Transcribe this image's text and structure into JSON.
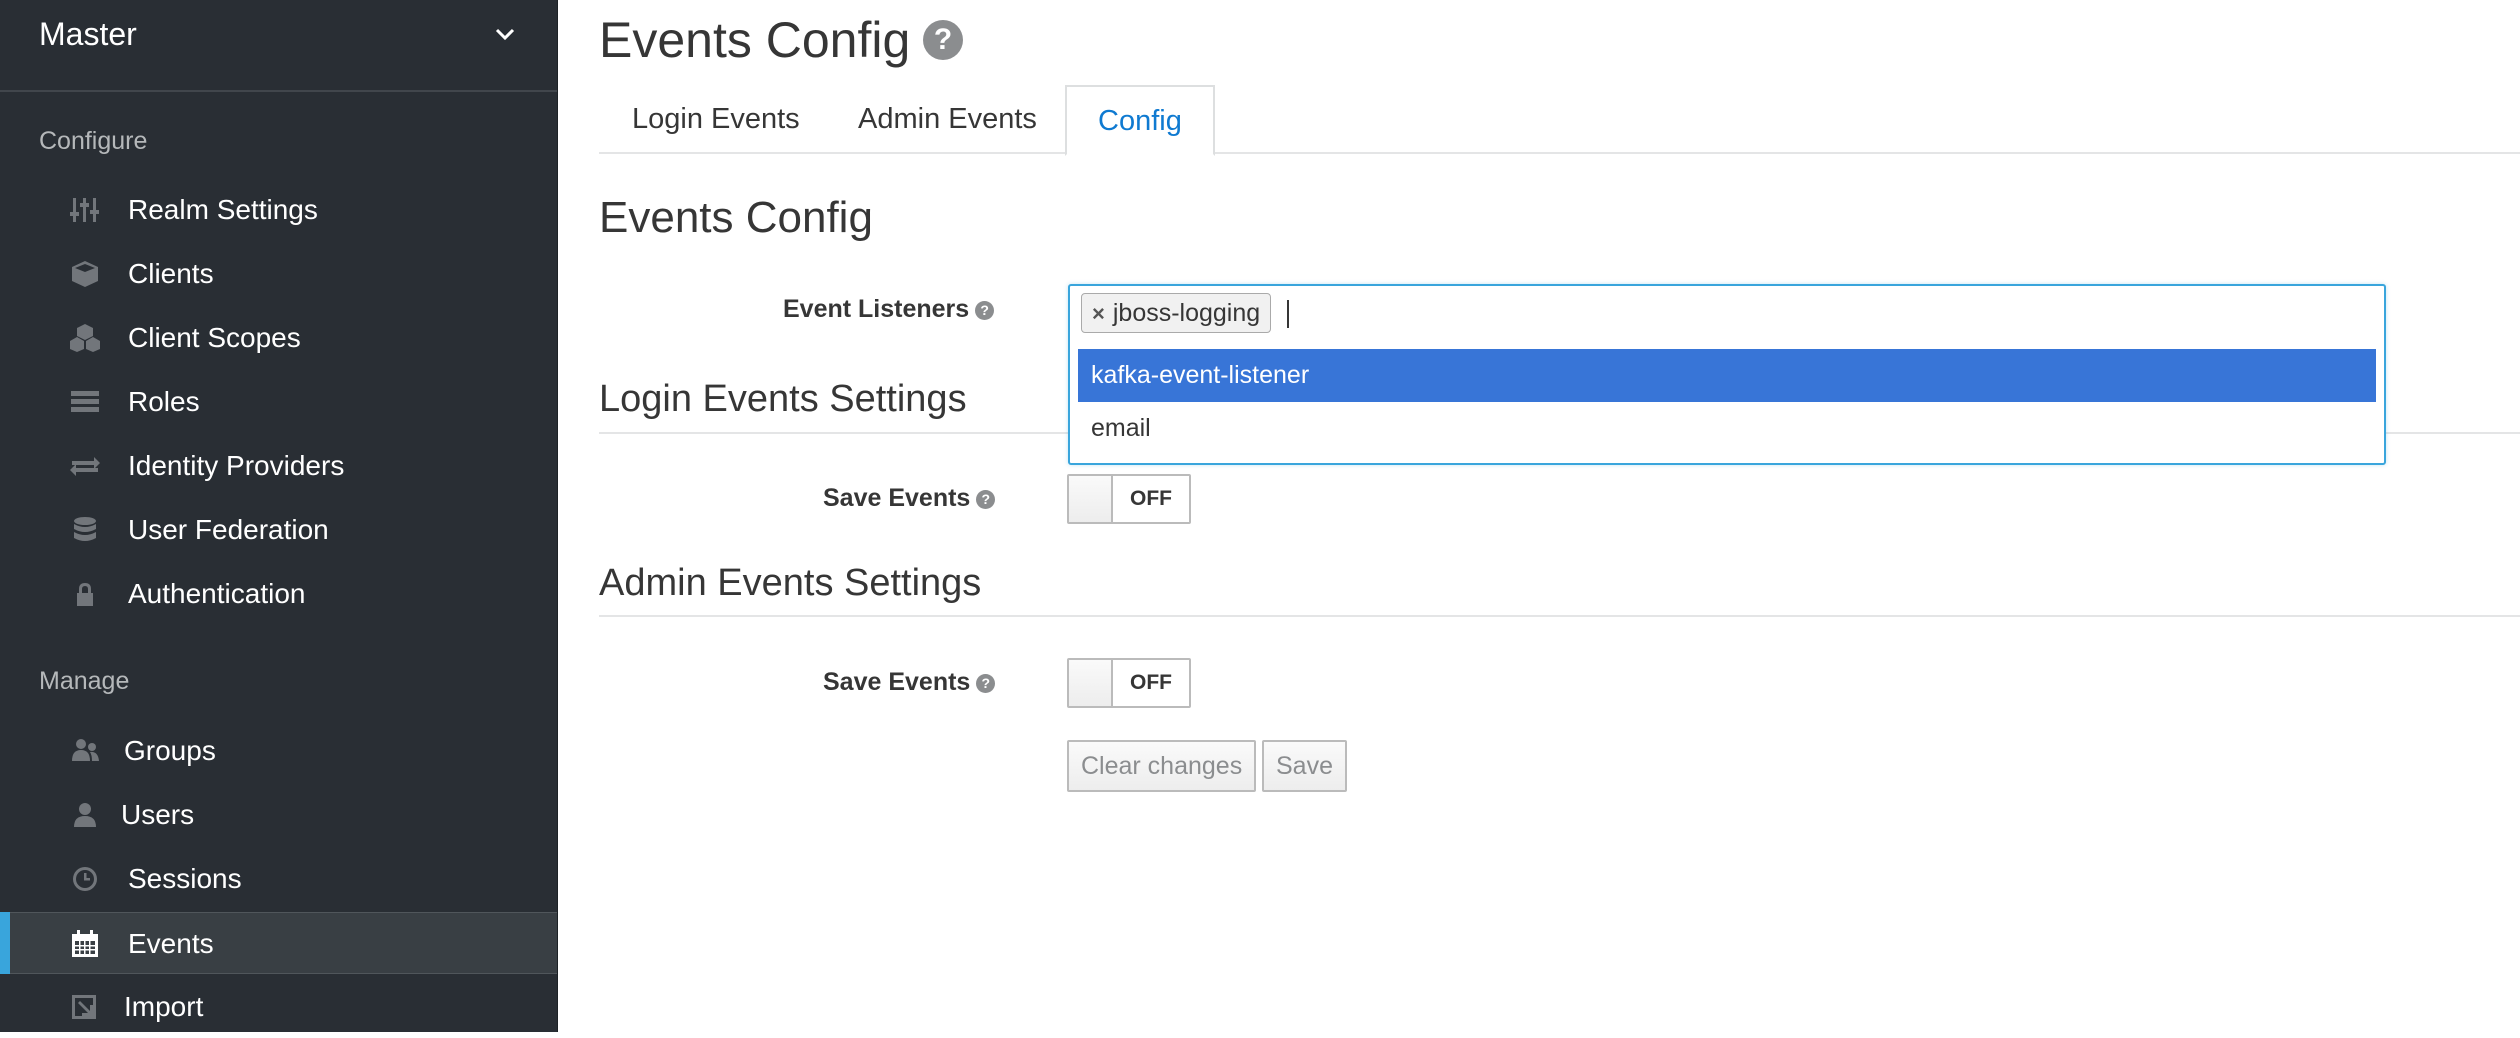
{
  "sidebar": {
    "realm": "Master",
    "configure_label": "Configure",
    "manage_label": "Manage",
    "configure_items": [
      {
        "label": "Realm Settings",
        "icon": "sliders-icon"
      },
      {
        "label": "Clients",
        "icon": "cube-icon"
      },
      {
        "label": "Client Scopes",
        "icon": "cubes-icon"
      },
      {
        "label": "Roles",
        "icon": "list-icon"
      },
      {
        "label": "Identity Providers",
        "icon": "exchange-icon"
      },
      {
        "label": "User Federation",
        "icon": "database-icon"
      },
      {
        "label": "Authentication",
        "icon": "lock-icon"
      }
    ],
    "manage_items": [
      {
        "label": "Groups",
        "icon": "users-icon"
      },
      {
        "label": "Users",
        "icon": "user-icon"
      },
      {
        "label": "Sessions",
        "icon": "clock-icon"
      },
      {
        "label": "Events",
        "icon": "calendar-icon",
        "active": true
      },
      {
        "label": "Import",
        "icon": "import-icon"
      }
    ]
  },
  "header": {
    "title": "Events Config"
  },
  "tabs": [
    {
      "label": "Login Events"
    },
    {
      "label": "Admin Events"
    },
    {
      "label": "Config",
      "active": true
    }
  ],
  "form": {
    "section_title": "Events Config",
    "event_listeners_label": "Event Listeners",
    "selected_listeners": [
      "jboss-logging"
    ],
    "dropdown_options": [
      {
        "label": "kafka-event-listener",
        "highlighted": true
      },
      {
        "label": "email"
      }
    ],
    "login_section_title": "Login Events Settings",
    "login_save_events_label": "Save Events",
    "login_save_events_state": "OFF",
    "admin_section_title": "Admin Events Settings",
    "admin_save_events_label": "Save Events",
    "admin_save_events_state": "OFF",
    "clear_button": "Clear changes",
    "save_button": "Save"
  },
  "colors": {
    "sidebar_bg": "#292e34",
    "active_accent": "#39a5dc",
    "tab_active": "#0f7ad1",
    "option_highlight": "#3875d7"
  }
}
